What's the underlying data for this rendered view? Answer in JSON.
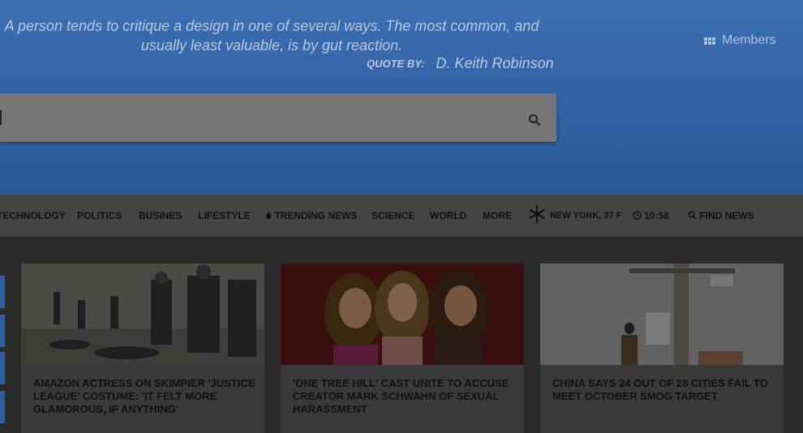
{
  "hero": {
    "quote": "A person tends to critique a design in one of several ways. The most common, and usually least valuable, is by gut reaction.",
    "quote_by_label": "QUOTE BY:",
    "quote_author": "D. Keith Robinson",
    "members_label": "Members"
  },
  "search": {
    "value": "",
    "placeholder": ""
  },
  "nav": {
    "items": [
      {
        "label": "TECHNOLOGY"
      },
      {
        "label": "POLITICS"
      },
      {
        "label": "BUSINES"
      },
      {
        "label": "LIFESTYLE"
      },
      {
        "label": "TRENDING NEWS"
      },
      {
        "label": "SCIENCE"
      },
      {
        "label": "WORLD"
      },
      {
        "label": "MORE"
      }
    ],
    "weather": "NEW YORK, 37 F",
    "time": "10:58",
    "find_news": "FIND NEWS"
  },
  "cards": [
    {
      "title": "AMAZON ACTRESS ON SKIMPIER 'JUSTICE LEAGUE' COSTUME: 'IT FELT MORE GLAMOROUS, IF ANYTHING'"
    },
    {
      "title": "'ONE TREE HILL' CAST UNITE TO ACCUSE CREATOR MARK SCHWAHN OF SEXUAL HARASSMENT"
    },
    {
      "title": "CHINA SAYS 24 OUT OF 28 CITIES FAIL TO MEET OCTOBER SMOG TARGET"
    }
  ],
  "colors": {
    "hero": "#3c6fb4",
    "overlay": "#2a2a2a"
  }
}
